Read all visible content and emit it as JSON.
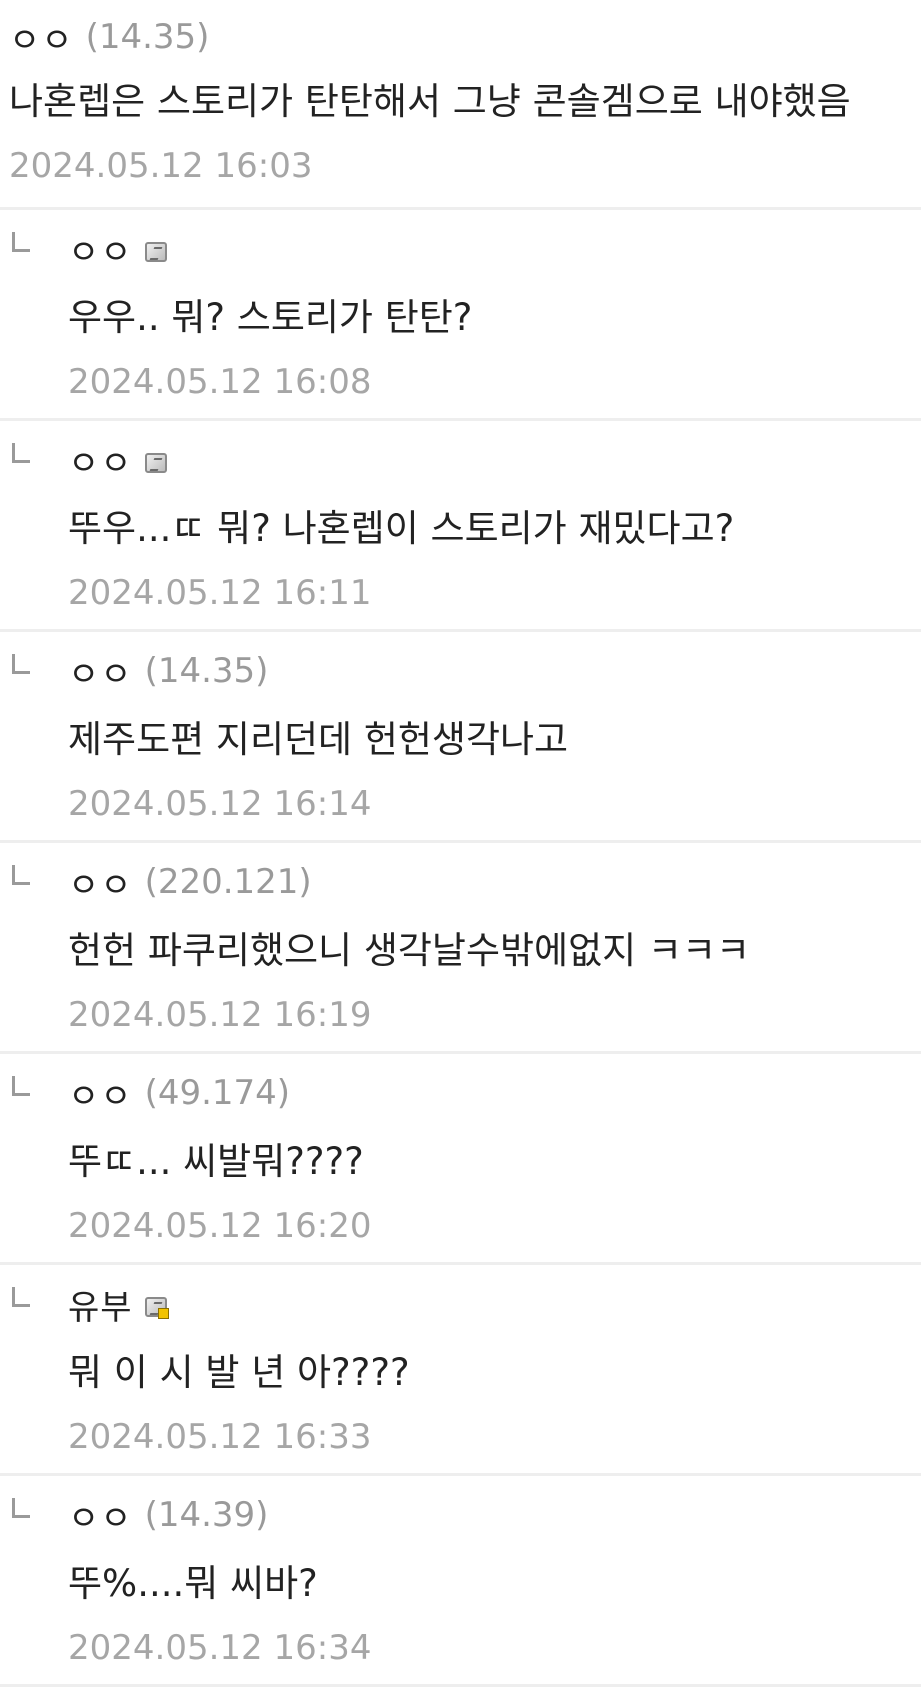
{
  "comments": [
    {
      "nick": "ㅇㅇ",
      "ip": "(14.35)",
      "text": "나혼렙은 스토리가 탄탄해서 그냥 콘솔겜으로 내야했음",
      "date": "2024.05.12 16:03"
    },
    {
      "nick": "ㅇㅇ",
      "badge": "fixed-nick-badge-icon",
      "text": "우우.. 뭐? 스토리가 탄탄?",
      "date": "2024.05.12 16:08"
    },
    {
      "nick": "ㅇㅇ",
      "badge": "fixed-nick-badge-icon",
      "text": "뚜우...ㄸ 뭐? 나혼렙이 스토리가 재밌다고?",
      "date": "2024.05.12 16:11"
    },
    {
      "nick": "ㅇㅇ",
      "ip": "(14.35)",
      "text": "제주도편 지리던데 헌헌생각나고",
      "date": "2024.05.12 16:14"
    },
    {
      "nick": "ㅇㅇ",
      "ip": "(220.121)",
      "text": "헌헌 파쿠리했으니 생각날수밖에없지 ㅋㅋㅋ",
      "date": "2024.05.12 16:19"
    },
    {
      "nick": "ㅇㅇ",
      "ip": "(49.174)",
      "text": "뚜ㄸ... 씨발뭐????",
      "date": "2024.05.12 16:20"
    },
    {
      "nick": "유부",
      "badge": "gallery-manager-badge-icon",
      "text": "뭐 이 시 발 년 아????",
      "date": "2024.05.12 16:33"
    },
    {
      "nick": "ㅇㅇ",
      "ip": "(14.39)",
      "text": "뚜%....뭐 씨바?",
      "date": "2024.05.12 16:34"
    }
  ],
  "colors": {
    "text": "#222222",
    "ip": "#9a9a9a",
    "date": "#a6a6a6",
    "divider": "#eeeeee"
  }
}
